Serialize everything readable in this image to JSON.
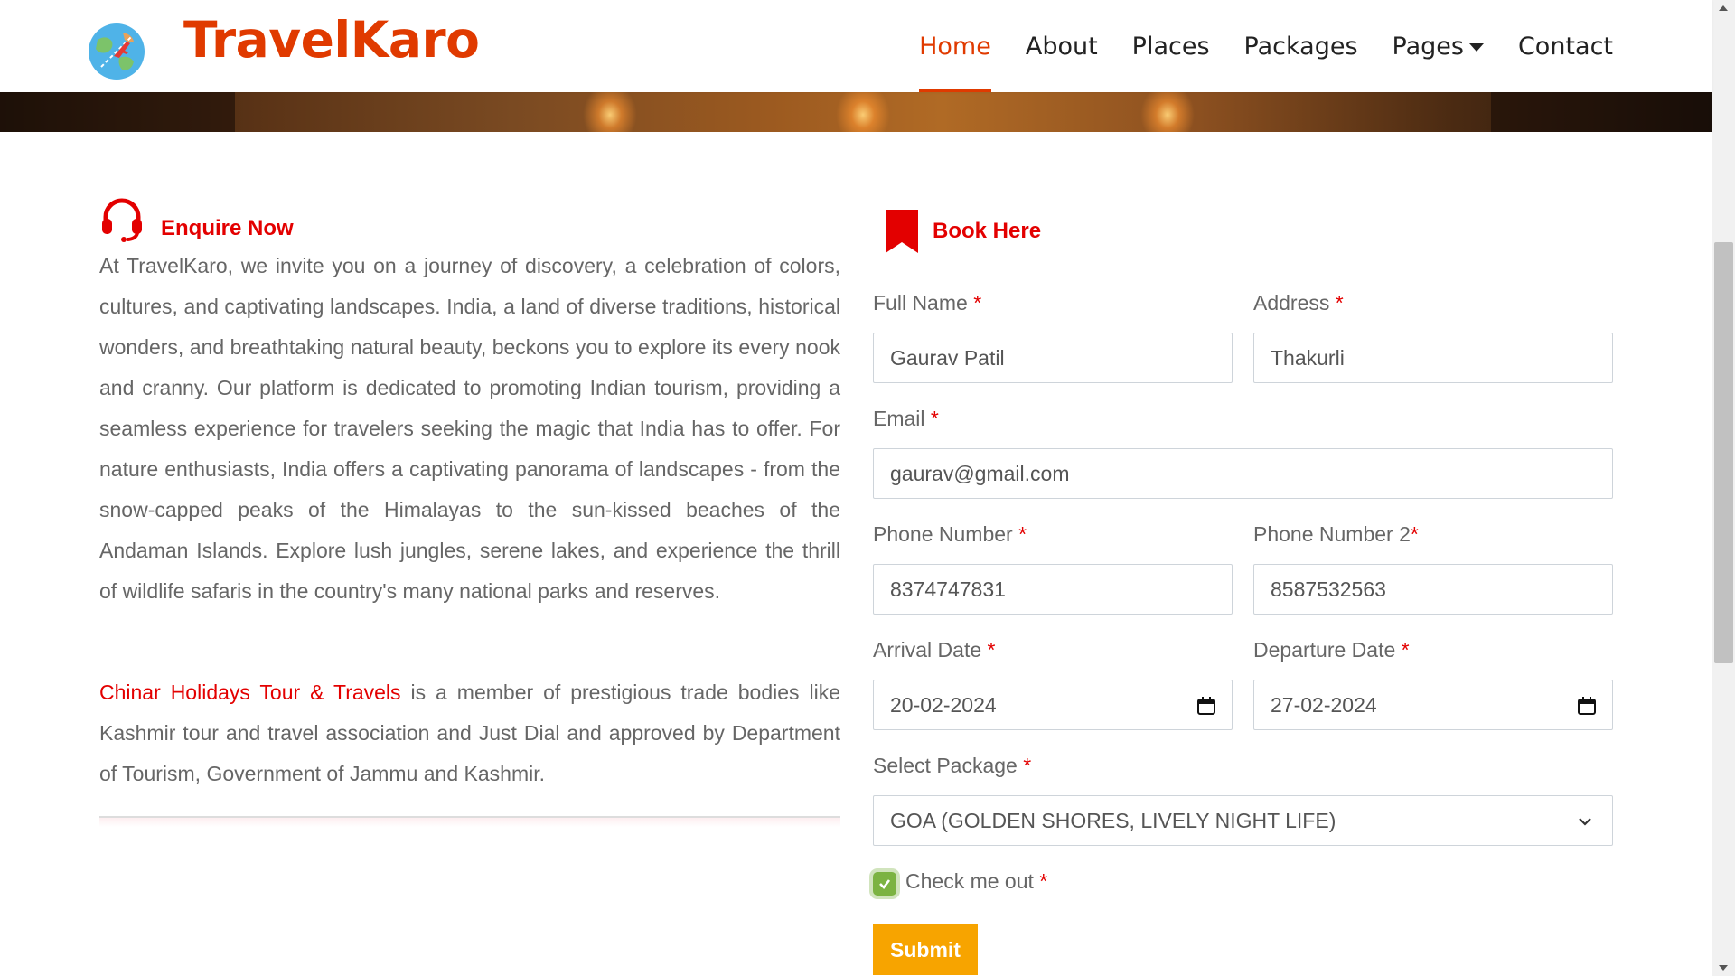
{
  "brand": {
    "name": "TravelKaro"
  },
  "nav": {
    "items": [
      {
        "label": "Home",
        "active": true
      },
      {
        "label": "About"
      },
      {
        "label": "Places"
      },
      {
        "label": "Packages"
      },
      {
        "label": "Pages",
        "dropdown": true
      },
      {
        "label": "Contact"
      }
    ]
  },
  "enquire": {
    "title": "Enquire Now",
    "icon": "headset-icon",
    "paragraph": "At TravelKaro, we invite you on a journey of discovery, a celebration of colors, cultures, and captivating landscapes. India, a land of diverse traditions, historical wonders, and breathtaking natural beauty, beckons you to explore its every nook and cranny. Our platform is dedicated to promoting Indian tourism, providing a seamless experience for travelers seeking the magic that India has to offer. For nature enthusiasts, India offers a captivating panorama of landscapes - from the snow-capped peaks of the Himalayas to the sun-kissed beaches of the Andaman Islands. Explore lush jungles, serene lakes, and experience the thrill of wildlife safaris in the country's many national parks and reserves.",
    "member_company": "Chinar Holidays Tour & Travels",
    "member_text": " is a member of prestigious trade bodies like Kashmir tour and travel association and Just Dial and approved by Department of Tourism, Government of Jammu and Kashmir."
  },
  "form": {
    "title": "Book Here",
    "icon": "bookmark-icon",
    "required_mark": "*",
    "full_name": {
      "label": "Full Name",
      "value": "Gaurav Patil"
    },
    "address": {
      "label": "Address",
      "value": "Thakurli"
    },
    "email": {
      "label": "Email",
      "value": "gaurav@gmail.com"
    },
    "phone": {
      "label": "Phone Number",
      "value": "8374747831"
    },
    "phone2": {
      "label": "Phone Number 2",
      "value": "8587532563"
    },
    "arrival": {
      "label": "Arrival Date",
      "value": "20-02-2024"
    },
    "departure": {
      "label": "Departure Date",
      "value": "27-02-2024"
    },
    "package": {
      "label": "Select Package",
      "value": "GOA (GOLDEN SHORES, LIVELY NIGHT LIFE)"
    },
    "checkbox": {
      "label": "Check me out",
      "checked": true
    },
    "submit_label": "Submit"
  },
  "colors": {
    "brand": "#e03a00",
    "accent_red": "#e30000",
    "submit": "#f7a400",
    "checkbox": "#7cb342"
  }
}
